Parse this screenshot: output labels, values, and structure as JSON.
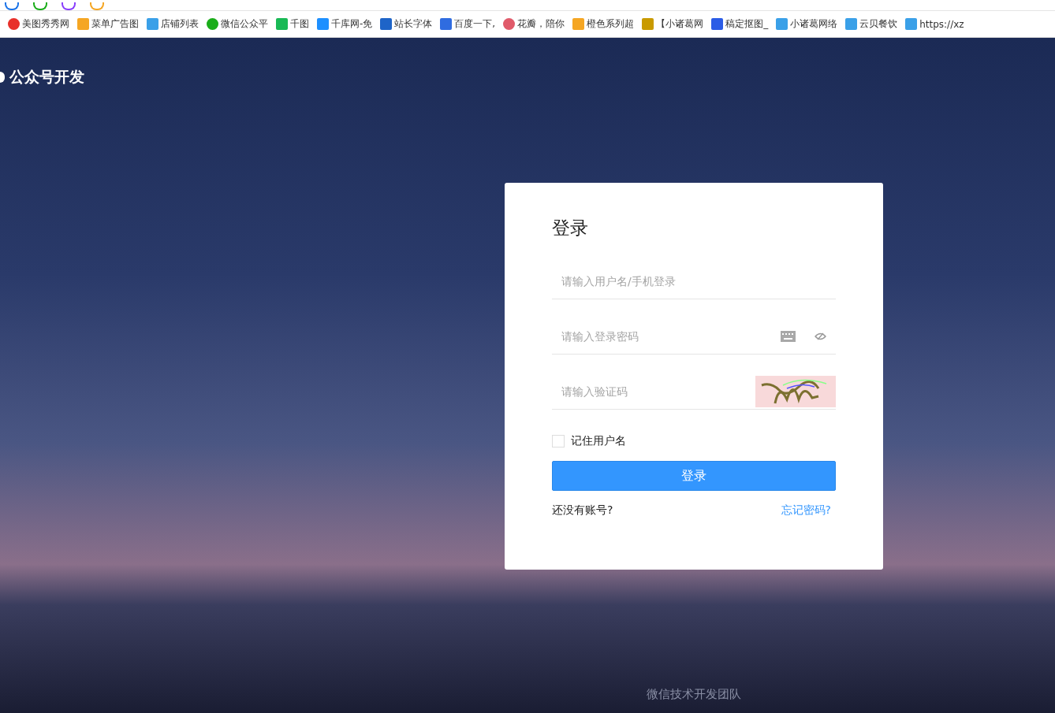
{
  "bookmarks": [
    {
      "label": "美图秀秀网"
    },
    {
      "label": "菜单广告图"
    },
    {
      "label": "店铺列表"
    },
    {
      "label": "微信公众平"
    },
    {
      "label": "千图"
    },
    {
      "label": "千库网-免"
    },
    {
      "label": "站长字体"
    },
    {
      "label": "百度一下,"
    },
    {
      "label": "花瓣，陪你"
    },
    {
      "label": "橙色系列超"
    },
    {
      "label": "【小诸葛网"
    },
    {
      "label": "稿定抠图_"
    },
    {
      "label": "小诸葛网络"
    },
    {
      "label": "云贝餐饮"
    },
    {
      "label": "https://xz"
    }
  ],
  "site_title": "公众号开发",
  "login": {
    "title": "登录",
    "username": {
      "placeholder": "请输入用户名/手机登录"
    },
    "password": {
      "placeholder": "请输入登录密码"
    },
    "captcha": {
      "placeholder": "请输入验证码"
    },
    "remember": {
      "label": "记住用户名",
      "checked": false
    },
    "submit": "登录",
    "register": "还没有账号?",
    "forgot": "忘记密码?"
  },
  "footer": "微信技术开发团队"
}
